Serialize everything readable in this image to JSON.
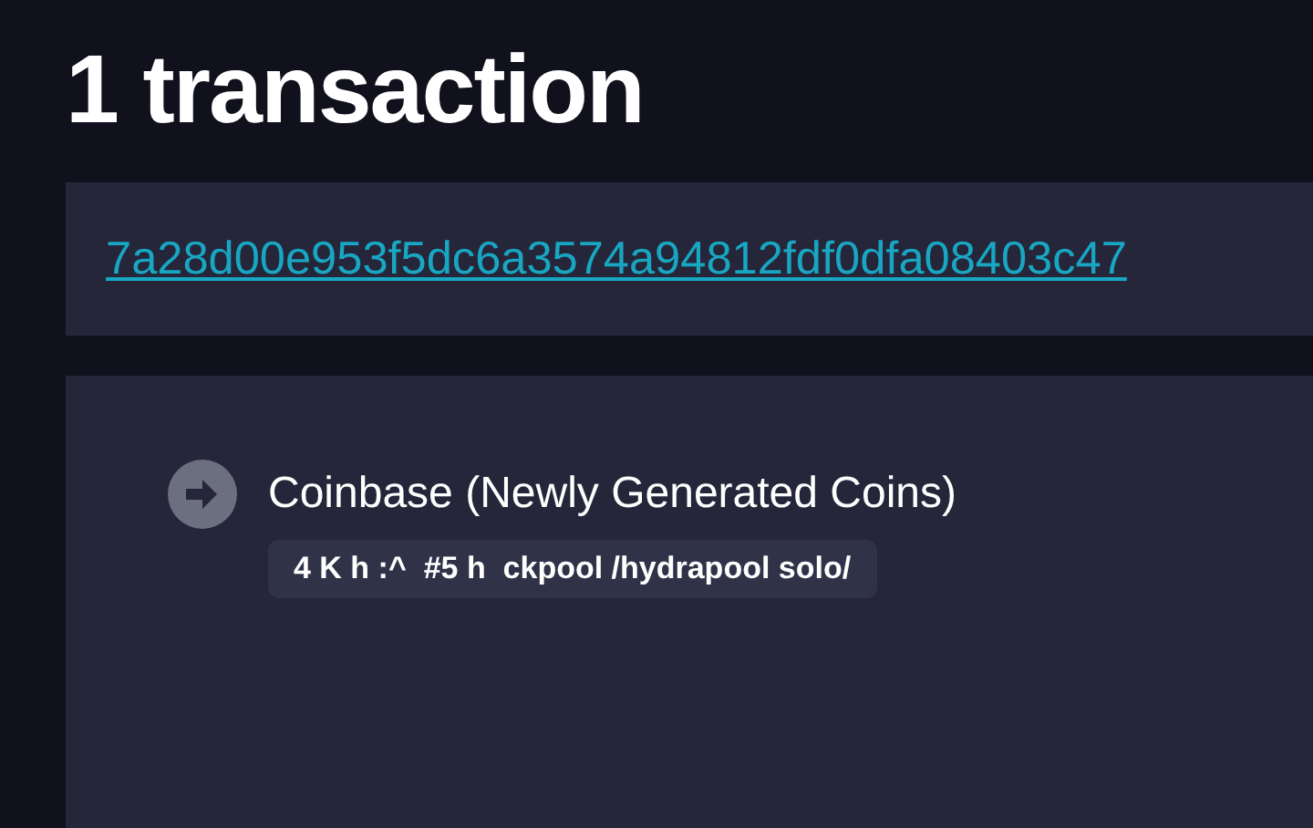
{
  "heading": "1 transaction",
  "transaction": {
    "txid": "7a28d00e953f5dc6a3574a94812fdf0dfa08403c47"
  },
  "inputs": [
    {
      "kind": "coinbase",
      "label": "Coinbase (Newly Generated Coins)",
      "script_tag": "4 K h :^  #5 h  ckpool /hydrapool solo/"
    }
  ]
}
